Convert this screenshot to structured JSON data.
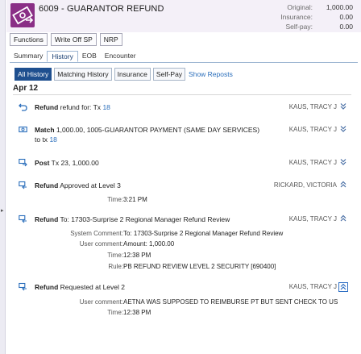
{
  "header": {
    "title": "6009 - GUARANTOR REFUND",
    "amounts": [
      {
        "label": "Original:",
        "value": "1,000.00"
      },
      {
        "label": "Insurance:",
        "value": "0.00"
      },
      {
        "label": "Self-pay:",
        "value": "0.00"
      }
    ]
  },
  "actions": [
    "Functions",
    "Write Off SP",
    "NRP"
  ],
  "tabs": [
    "Summary",
    "History",
    "EOB",
    "Encounter"
  ],
  "subtabs": [
    "All History",
    "Matching History",
    "Insurance",
    "Self-Pay"
  ],
  "show_link": "Show Reposts",
  "date": "Apr 12",
  "entries": [
    {
      "action": "Refund",
      "text": "refund for: Tx",
      "link": "18",
      "user": "KAUS, TRACY J"
    },
    {
      "action": "Match",
      "text": "1,000.00, 1005-GUARANTOR PAYMENT (SAME DAY SERVICES) to tx",
      "link": "18",
      "user": "KAUS, TRACY J"
    },
    {
      "action": "Post",
      "text": "Tx 23, 1,000.00",
      "user": "KAUS, TRACY J"
    },
    {
      "action": "Refund",
      "text": "Approved at Level 3",
      "user": "RICKARD, VICTORIA",
      "details": [
        {
          "label": "Time:",
          "value": "3:21 PM"
        }
      ]
    },
    {
      "action": "Refund",
      "text": "To: 17303-Surprise 2 Regional Manager Refund Review",
      "user": "KAUS, TRACY J",
      "details": [
        {
          "label": "System Comment:",
          "value": "To: 17303-Surprise 2 Regional Manager Refund Review"
        },
        {
          "label": "User comment:",
          "value": "Amount: 1,000.00"
        },
        {
          "label": "Time:",
          "value": "12:38 PM"
        },
        {
          "label": "Rule:",
          "value": "PB REFUND REVIEW LEVEL 2 SECURITY [690400]"
        }
      ]
    },
    {
      "action": "Refund",
      "text": "Requested at Level 2",
      "user": "KAUS, TRACY J",
      "details": [
        {
          "label": "User comment:",
          "value": "AETNA WAS SUPPOSED TO REIMBURSE PT BUT SENT CHECK TO US"
        },
        {
          "label": "Time:",
          "value": "12:38 PM"
        }
      ]
    }
  ],
  "icons": {
    "logo": "refund-card-icon",
    "refund": "undo-arrow-icon",
    "match": "money-icon",
    "post": "post-payment-icon",
    "refund_workflow": "refund-workflow-icon",
    "chevron_down": "double-chevron-down-icon",
    "chevron_up": "double-chevron-up-icon"
  },
  "colors": {
    "brand": "#8a2f86",
    "accent": "#1e4f8f",
    "link": "#2a6ebb"
  }
}
